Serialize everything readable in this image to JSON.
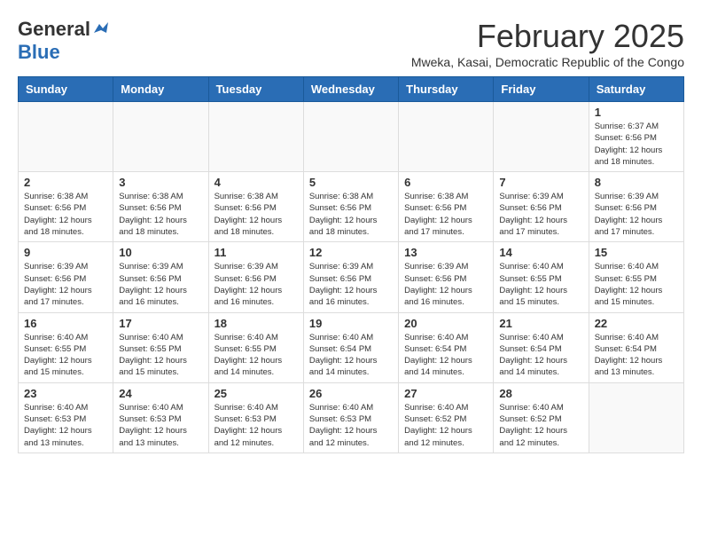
{
  "logo": {
    "general": "General",
    "blue": "Blue"
  },
  "title": "February 2025",
  "location": "Mweka, Kasai, Democratic Republic of the Congo",
  "days_of_week": [
    "Sunday",
    "Monday",
    "Tuesday",
    "Wednesday",
    "Thursday",
    "Friday",
    "Saturday"
  ],
  "weeks": [
    [
      {
        "day": "",
        "info": ""
      },
      {
        "day": "",
        "info": ""
      },
      {
        "day": "",
        "info": ""
      },
      {
        "day": "",
        "info": ""
      },
      {
        "day": "",
        "info": ""
      },
      {
        "day": "",
        "info": ""
      },
      {
        "day": "1",
        "info": "Sunrise: 6:37 AM\nSunset: 6:56 PM\nDaylight: 12 hours\nand 18 minutes."
      }
    ],
    [
      {
        "day": "2",
        "info": "Sunrise: 6:38 AM\nSunset: 6:56 PM\nDaylight: 12 hours\nand 18 minutes."
      },
      {
        "day": "3",
        "info": "Sunrise: 6:38 AM\nSunset: 6:56 PM\nDaylight: 12 hours\nand 18 minutes."
      },
      {
        "day": "4",
        "info": "Sunrise: 6:38 AM\nSunset: 6:56 PM\nDaylight: 12 hours\nand 18 minutes."
      },
      {
        "day": "5",
        "info": "Sunrise: 6:38 AM\nSunset: 6:56 PM\nDaylight: 12 hours\nand 18 minutes."
      },
      {
        "day": "6",
        "info": "Sunrise: 6:38 AM\nSunset: 6:56 PM\nDaylight: 12 hours\nand 17 minutes."
      },
      {
        "day": "7",
        "info": "Sunrise: 6:39 AM\nSunset: 6:56 PM\nDaylight: 12 hours\nand 17 minutes."
      },
      {
        "day": "8",
        "info": "Sunrise: 6:39 AM\nSunset: 6:56 PM\nDaylight: 12 hours\nand 17 minutes."
      }
    ],
    [
      {
        "day": "9",
        "info": "Sunrise: 6:39 AM\nSunset: 6:56 PM\nDaylight: 12 hours\nand 17 minutes."
      },
      {
        "day": "10",
        "info": "Sunrise: 6:39 AM\nSunset: 6:56 PM\nDaylight: 12 hours\nand 16 minutes."
      },
      {
        "day": "11",
        "info": "Sunrise: 6:39 AM\nSunset: 6:56 PM\nDaylight: 12 hours\nand 16 minutes."
      },
      {
        "day": "12",
        "info": "Sunrise: 6:39 AM\nSunset: 6:56 PM\nDaylight: 12 hours\nand 16 minutes."
      },
      {
        "day": "13",
        "info": "Sunrise: 6:39 AM\nSunset: 6:56 PM\nDaylight: 12 hours\nand 16 minutes."
      },
      {
        "day": "14",
        "info": "Sunrise: 6:40 AM\nSunset: 6:55 PM\nDaylight: 12 hours\nand 15 minutes."
      },
      {
        "day": "15",
        "info": "Sunrise: 6:40 AM\nSunset: 6:55 PM\nDaylight: 12 hours\nand 15 minutes."
      }
    ],
    [
      {
        "day": "16",
        "info": "Sunrise: 6:40 AM\nSunset: 6:55 PM\nDaylight: 12 hours\nand 15 minutes."
      },
      {
        "day": "17",
        "info": "Sunrise: 6:40 AM\nSunset: 6:55 PM\nDaylight: 12 hours\nand 15 minutes."
      },
      {
        "day": "18",
        "info": "Sunrise: 6:40 AM\nSunset: 6:55 PM\nDaylight: 12 hours\nand 14 minutes."
      },
      {
        "day": "19",
        "info": "Sunrise: 6:40 AM\nSunset: 6:54 PM\nDaylight: 12 hours\nand 14 minutes."
      },
      {
        "day": "20",
        "info": "Sunrise: 6:40 AM\nSunset: 6:54 PM\nDaylight: 12 hours\nand 14 minutes."
      },
      {
        "day": "21",
        "info": "Sunrise: 6:40 AM\nSunset: 6:54 PM\nDaylight: 12 hours\nand 14 minutes."
      },
      {
        "day": "22",
        "info": "Sunrise: 6:40 AM\nSunset: 6:54 PM\nDaylight: 12 hours\nand 13 minutes."
      }
    ],
    [
      {
        "day": "23",
        "info": "Sunrise: 6:40 AM\nSunset: 6:53 PM\nDaylight: 12 hours\nand 13 minutes."
      },
      {
        "day": "24",
        "info": "Sunrise: 6:40 AM\nSunset: 6:53 PM\nDaylight: 12 hours\nand 13 minutes."
      },
      {
        "day": "25",
        "info": "Sunrise: 6:40 AM\nSunset: 6:53 PM\nDaylight: 12 hours\nand 12 minutes."
      },
      {
        "day": "26",
        "info": "Sunrise: 6:40 AM\nSunset: 6:53 PM\nDaylight: 12 hours\nand 12 minutes."
      },
      {
        "day": "27",
        "info": "Sunrise: 6:40 AM\nSunset: 6:52 PM\nDaylight: 12 hours\nand 12 minutes."
      },
      {
        "day": "28",
        "info": "Sunrise: 6:40 AM\nSunset: 6:52 PM\nDaylight: 12 hours\nand 12 minutes."
      },
      {
        "day": "",
        "info": ""
      }
    ]
  ]
}
